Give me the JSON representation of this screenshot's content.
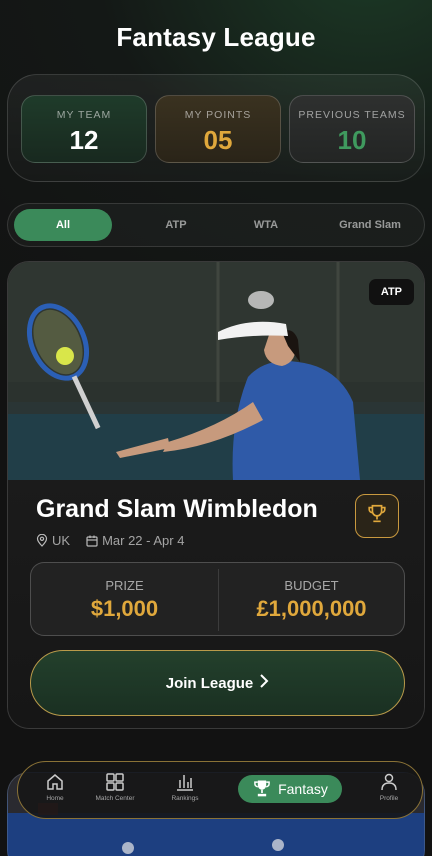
{
  "header": {
    "title": "Fantasy League"
  },
  "stats": {
    "my_team": {
      "label": "MY TEAM",
      "value": "12"
    },
    "my_points": {
      "label": "MY POINTS",
      "value": "05"
    },
    "previous_teams": {
      "label": "PREVIOUS TEAMS",
      "value": "10"
    }
  },
  "filters": {
    "tabs": [
      "All",
      "ATP",
      "WTA",
      "Grand Slam"
    ],
    "selected": "All"
  },
  "league_card": {
    "badge": "ATP",
    "title": "Grand Slam Wimbledon",
    "location": "UK",
    "dates": "Mar 22 - Apr 4",
    "prize_label": "PRIZE",
    "prize_value": "$1,000",
    "budget_label": "BUDGET",
    "budget_value": "£1,000,000",
    "join_label": "Join League",
    "trophy_icon": "trophy-icon"
  },
  "bottom_nav": {
    "items": [
      {
        "label": "Home",
        "icon": "home-icon"
      },
      {
        "label": "Match Center",
        "icon": "grid-icon"
      },
      {
        "label": "Rankings",
        "icon": "bar-chart-icon"
      },
      {
        "label": "Fantasy",
        "icon": "trophy-icon"
      },
      {
        "label": "Profile",
        "icon": "user-icon"
      }
    ],
    "active": "Fantasy"
  },
  "colors": {
    "accent_green": "#3b8a5a",
    "gold": "#e0a83c",
    "background": "#121212"
  }
}
